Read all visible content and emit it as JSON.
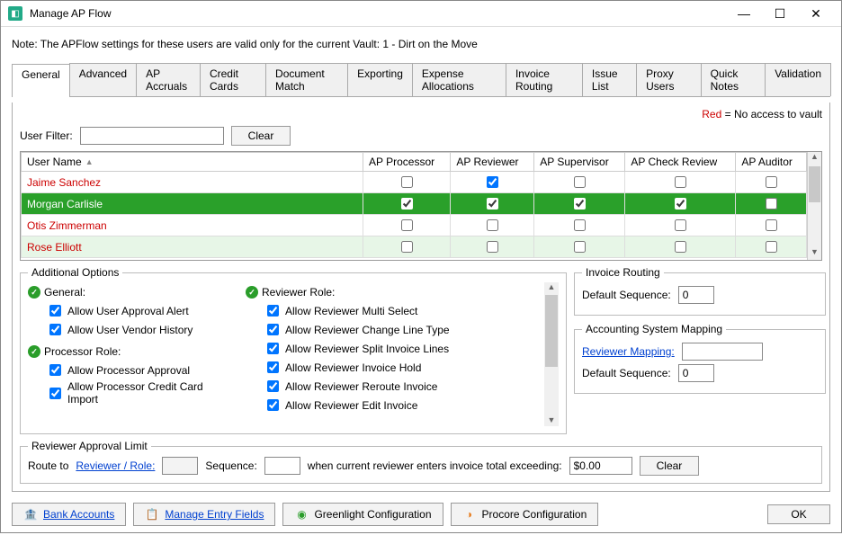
{
  "window": {
    "title": "Manage AP Flow"
  },
  "note": "Note:  The APFlow settings for these users are valid only for the current Vault: 1 - Dirt on the Move",
  "tabs": [
    "General",
    "Advanced",
    "AP Accruals",
    "Credit Cards",
    "Document Match",
    "Exporting",
    "Expense Allocations",
    "Invoice Routing",
    "Issue List",
    "Proxy Users",
    "Quick Notes",
    "Validation"
  ],
  "active_tab": "General",
  "legend": {
    "red_label": "Red",
    "red_text": " = No access to vault"
  },
  "filter": {
    "label": "User Filter:",
    "value": "",
    "clear": "Clear"
  },
  "grid": {
    "columns": [
      "User Name",
      "AP Processor",
      "AP Reviewer",
      "AP Supervisor",
      "AP Check Review",
      "AP Auditor"
    ],
    "rows": [
      {
        "name": "Jaime Sanchez",
        "no_access": true,
        "selected": false,
        "highlight": false,
        "cells": [
          false,
          true,
          false,
          false,
          false
        ]
      },
      {
        "name": "Morgan Carlisle",
        "no_access": false,
        "selected": true,
        "highlight": false,
        "cells": [
          true,
          true,
          true,
          true,
          false
        ]
      },
      {
        "name": "Otis Zimmerman",
        "no_access": true,
        "selected": false,
        "highlight": false,
        "cells": [
          false,
          false,
          false,
          false,
          false
        ]
      },
      {
        "name": "Rose Elliott",
        "no_access": true,
        "selected": false,
        "highlight": true,
        "cells": [
          false,
          false,
          false,
          false,
          false
        ]
      }
    ]
  },
  "additional": {
    "legend": "Additional Options",
    "general": {
      "title": "General:",
      "items": [
        {
          "label": "Allow User Approval Alert",
          "checked": true
        },
        {
          "label": "Allow User Vendor History",
          "checked": true
        }
      ]
    },
    "processor": {
      "title": "Processor Role:",
      "items": [
        {
          "label": "Allow Processor Approval",
          "checked": true
        },
        {
          "label": "Allow Processor Credit Card Import",
          "checked": true
        }
      ]
    },
    "reviewer": {
      "title": "Reviewer Role:",
      "items": [
        {
          "label": "Allow Reviewer Multi Select",
          "checked": true
        },
        {
          "label": "Allow Reviewer Change Line Type",
          "checked": true
        },
        {
          "label": "Allow Reviewer Split Invoice Lines",
          "checked": true
        },
        {
          "label": "Allow Reviewer Invoice Hold",
          "checked": true
        },
        {
          "label": "Allow Reviewer Reroute Invoice",
          "checked": true
        },
        {
          "label": "Allow Reviewer Edit Invoice",
          "checked": true
        }
      ]
    }
  },
  "invoice_routing": {
    "legend": "Invoice Routing",
    "default_seq_label": "Default Sequence:",
    "default_seq_value": "0"
  },
  "mapping": {
    "legend": "Accounting System Mapping",
    "reviewer_mapping_label": "Reviewer Mapping:",
    "reviewer_mapping_value": "",
    "default_seq_label": "Default Sequence:",
    "default_seq_value": "0"
  },
  "approval_limit": {
    "legend": "Reviewer Approval Limit",
    "route_to": "Route to",
    "reviewer_role": "Reviewer / Role:",
    "reviewer_value": "",
    "sequence_label": "Sequence:",
    "sequence_value": "",
    "when_text": "when current reviewer enters invoice total exceeding:",
    "amount": "$0.00",
    "clear": "Clear"
  },
  "footer": {
    "bank": "Bank Accounts",
    "entry": "Manage Entry Fields",
    "greenlight": "Greenlight Configuration",
    "procore": "Procore Configuration",
    "ok": "OK"
  }
}
